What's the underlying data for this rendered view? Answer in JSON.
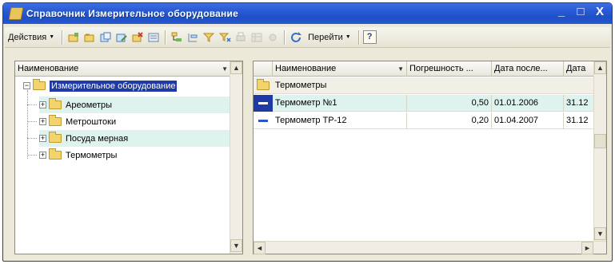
{
  "window": {
    "title": "Справочник Измерительное оборудование",
    "controls": [
      "_",
      "□",
      "X"
    ]
  },
  "toolbar": {
    "actions_label": "Действия",
    "goto_label": "Перейти",
    "help_label": "?"
  },
  "tree": {
    "header": "Наименование",
    "root": "Измерительное оборудование",
    "items": [
      "Ареометры",
      "Метроштоки",
      "Посуда мерная",
      "Термометры"
    ]
  },
  "table": {
    "columns": [
      "Наименование",
      "Погрешность ...",
      "Дата после...",
      "Дата"
    ],
    "group_row": "Термометры",
    "rows": [
      {
        "name": "Термометр №1",
        "error": "0,50",
        "date1": "01.01.2006",
        "date2": "31.12"
      },
      {
        "name": "Термометр ТР-12",
        "error": "0,20",
        "date1": "01.04.2007",
        "date2": "31.12"
      }
    ]
  },
  "colors": {
    "title_bar": "#2a5bd7",
    "selection": "#1f3aa5",
    "row_highlight": "#dff3ee"
  }
}
